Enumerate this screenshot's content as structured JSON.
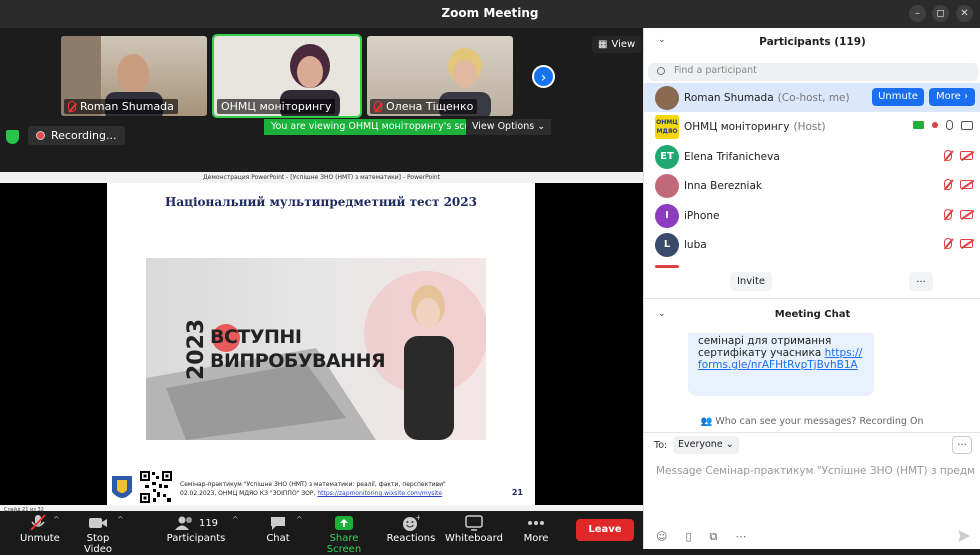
{
  "window": {
    "title": "Zoom Meeting"
  },
  "thumbnails": [
    {
      "name": "Roman Shumada",
      "muted": true
    },
    {
      "name": "ОНМЦ моніторингу",
      "muted": false,
      "active": true
    },
    {
      "name": "Олена Тіщенко",
      "muted": true
    }
  ],
  "view_button": "View",
  "viewing_banner": "You are viewing ОНМЦ моніторингу's screen",
  "view_options": "View Options",
  "recording": "Recording...",
  "share": {
    "window_title": "Демонстрация PowerPoint - [Успішне ЗНО (НМТ) з математики] - PowerPoint",
    "slide_title": "Національний мультипредметний тест 2023",
    "img_year": "2023",
    "img_word1": "ВСТУПНІ",
    "img_word2": "ВИПРОБУВАННЯ",
    "footer_line1": "Семінар-практикум \"Успішне ЗНО (НМТ) з математики: реалії, факти, перспективи\"",
    "footer_line2": "02.02.2023, ОНМЦ МДЯО КЗ \"ЗОІППО\" ЗОР,",
    "footer_link": "https://zapmonitoring.wixsite.com/mysite",
    "slide_number": "21",
    "status": "Слайд 21 из 32"
  },
  "toolbar": {
    "unmute": "Unmute",
    "stop_video": "Stop Video",
    "participants": "Participants",
    "participants_count": "119",
    "chat": "Chat",
    "share_screen": "Share Screen",
    "reactions": "Reactions",
    "whiteboard": "Whiteboard",
    "more": "More",
    "leave": "Leave"
  },
  "participants_panel": {
    "title": "Participants (119)",
    "search_placeholder": "Find a participant",
    "unmute_btn": "Unmute",
    "more_btn": "More",
    "invite": "Invite",
    "more3": "...",
    "list": [
      {
        "name": "Roman Shumada",
        "role": "(Co-host, me)",
        "initials": "",
        "color": "#8a6a50"
      },
      {
        "name": "ОНМЦ моніторингу",
        "role": "(Host)",
        "initials": "ОНМЦ МДЯО",
        "color": "#f5d60a"
      },
      {
        "name": "Elena Trifanicheva",
        "role": "",
        "initials": "ET",
        "color": "#1fa872"
      },
      {
        "name": "Inna Berezniak",
        "role": "",
        "initials": "",
        "color": "#c26a7a"
      },
      {
        "name": "iPhone",
        "role": "",
        "initials": "I",
        "color": "#8c3cbf"
      },
      {
        "name": "luba",
        "role": "",
        "initials": "L",
        "color": "#3a4a6a"
      }
    ]
  },
  "chat_panel": {
    "title": "Meeting Chat",
    "msg_line1": "семінарі для отримання",
    "msg_line2": "сертифікату учасника",
    "msg_link1": "https://",
    "msg_link2": "forms.gle/nrAFHtRvpTjBvhB1A",
    "who_can": "Who can see your messages? Recording On",
    "to_label": "To:",
    "to_value": "Everyone",
    "dots": "...",
    "message_placeholder": "Message Семінар-практикум \"Успішне ЗНО (НМТ)  з предм..."
  },
  "colors": {
    "accent": "#1a6ff0",
    "share_green": "#1bb13a",
    "leave_red": "#e02828"
  }
}
